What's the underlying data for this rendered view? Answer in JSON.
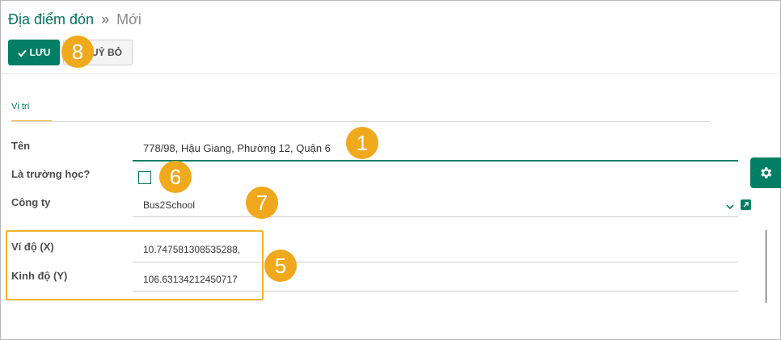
{
  "breadcrumb": {
    "parent": "Địa điểm đón",
    "separator": "»",
    "current": "Mới"
  },
  "toolbar": {
    "save_label": "LƯU",
    "discard_label": "UỶ BỎ"
  },
  "tabs": [
    {
      "label": "Vị trí"
    }
  ],
  "form": {
    "name": {
      "label": "Tên",
      "value": "778/98, Hậu Giang, Phường 12, Quận 6"
    },
    "is_school": {
      "label": "Là trường học?",
      "checked": false
    },
    "company": {
      "label": "Công ty",
      "value": "Bus2School"
    },
    "latitude": {
      "label": "Ví độ (X)",
      "value": "10.747581308535288,"
    },
    "longitude": {
      "label": "Kinh độ (Y)",
      "value": "106.63134212450717"
    }
  },
  "badges": [
    "1",
    "6",
    "7",
    "5",
    "8"
  ],
  "icons": {
    "save": "check-icon",
    "settings": "gear-icon",
    "dropdown": "chevron-down-icon",
    "external": "external-link-icon"
  },
  "colors": {
    "primary": "#017e63",
    "badge": "#f0a91c",
    "highlight": "#f0b429"
  }
}
